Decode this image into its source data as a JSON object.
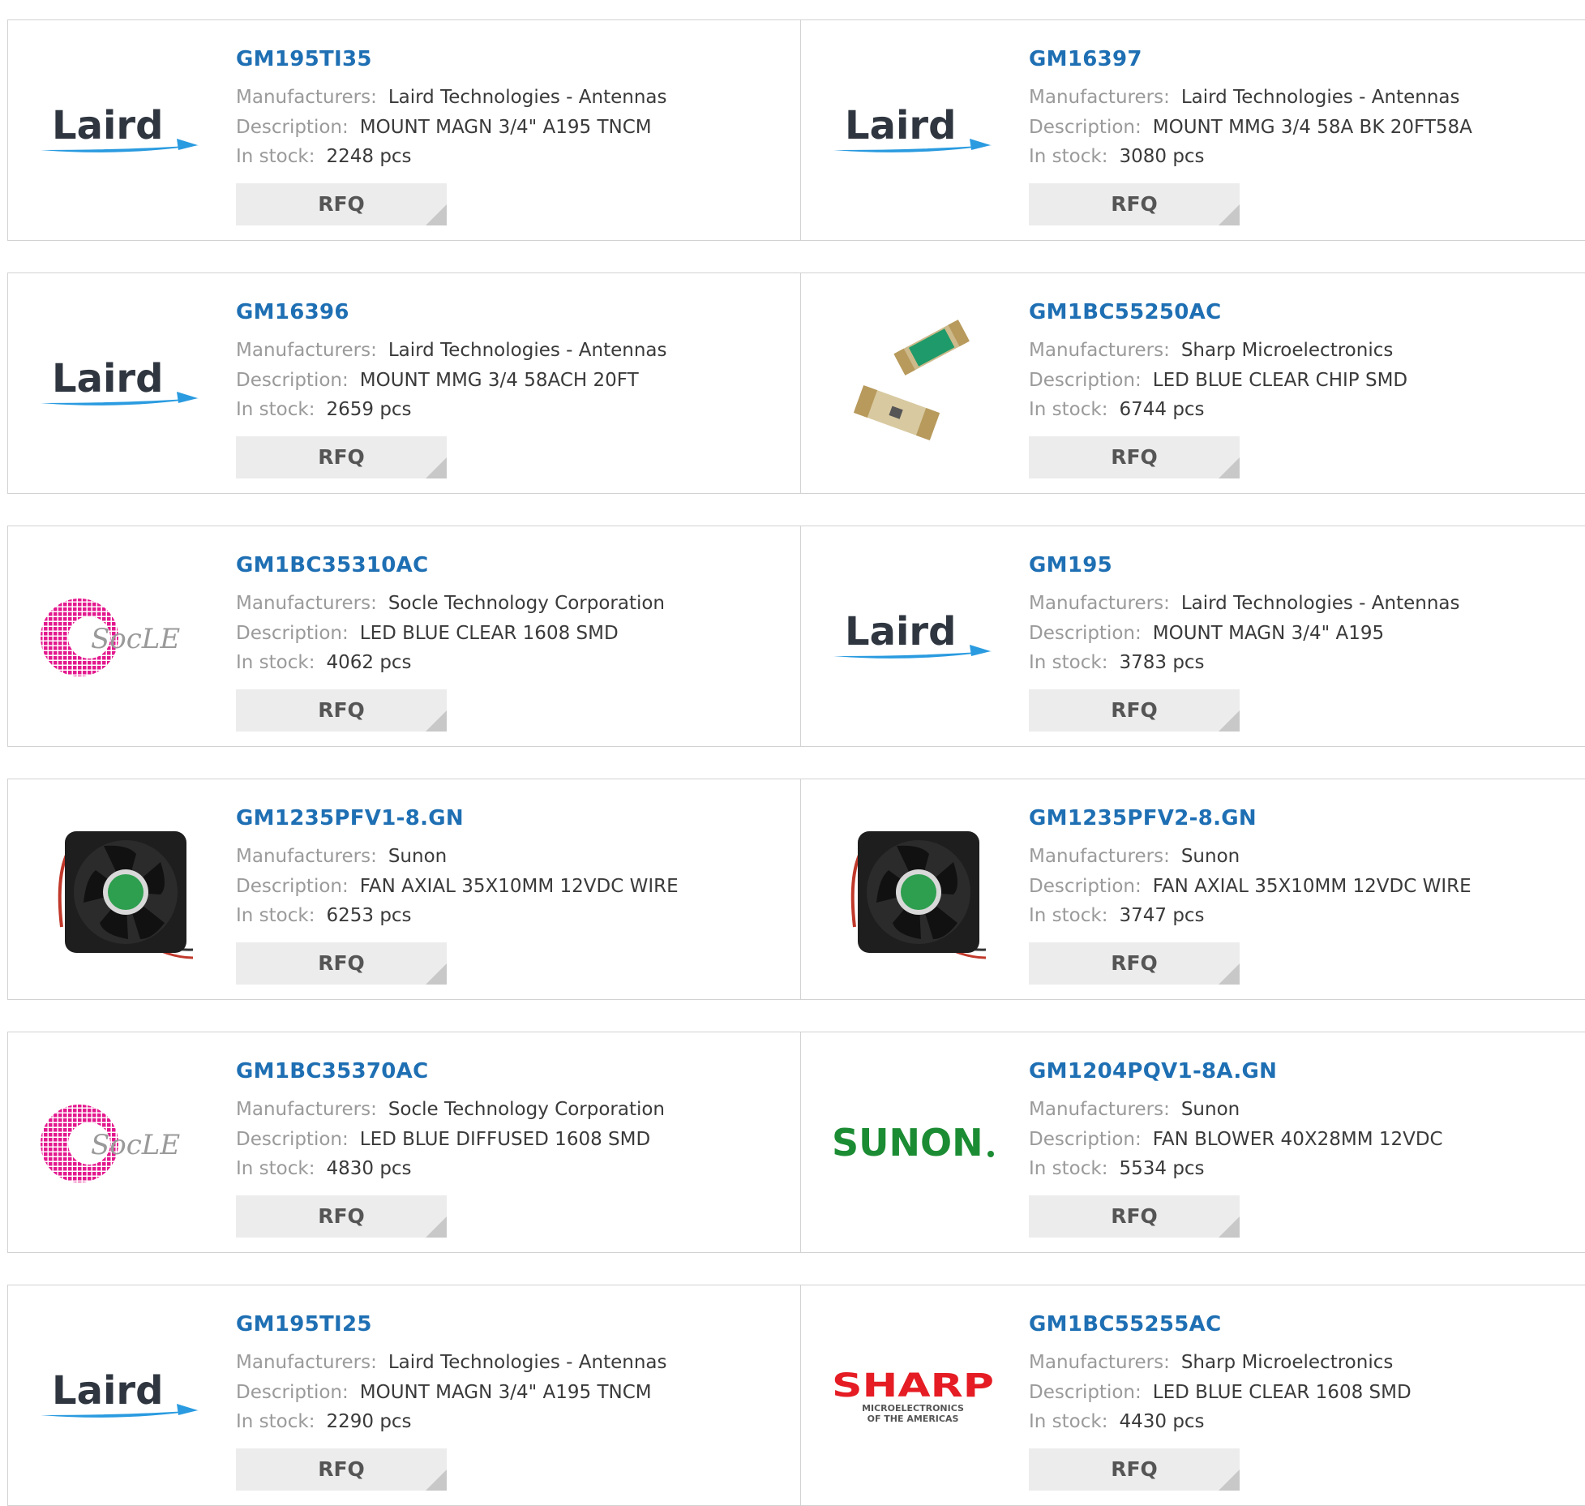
{
  "labels": {
    "manufacturers": "Manufacturers:",
    "description": "Description:",
    "in_stock": "In stock:"
  },
  "rows": [
    {
      "cards": [
        {
          "part_number": "GM195TI35",
          "manufacturer": "Laird Technologies - Antennas",
          "description": "MOUNT MAGN 3/4\" A195 TNCM",
          "stock": "2248 pcs",
          "button": "RFQ",
          "logo": "laird-logo"
        },
        {
          "part_number": "GM16397",
          "manufacturer": "Laird Technologies - Antennas",
          "description": "MOUNT MMG 3/4 58A BK 20FT58A",
          "stock": "3080 pcs",
          "button": "RFQ",
          "logo": "laird-logo"
        }
      ]
    },
    {
      "cards": [
        {
          "part_number": "GM16396",
          "manufacturer": "Laird Technologies - Antennas",
          "description": "MOUNT MMG 3/4 58ACH 20FT",
          "stock": "2659 pcs",
          "button": "RFQ",
          "logo": "laird-logo"
        },
        {
          "part_number": "GM1BC55250AC",
          "manufacturer": "Sharp Microelectronics",
          "description": "LED BLUE CLEAR CHIP SMD",
          "stock": "6744 pcs",
          "button": "RFQ",
          "logo": "led-chip-photo"
        }
      ]
    },
    {
      "cards": [
        {
          "part_number": "GM1BC35310AC",
          "manufacturer": "Socle Technology Corporation",
          "description": "LED BLUE CLEAR 1608 SMD",
          "stock": "4062 pcs",
          "button": "RFQ",
          "logo": "socle-logo"
        },
        {
          "part_number": "GM195",
          "manufacturer": "Laird Technologies - Antennas",
          "description": "MOUNT MAGN 3/4\" A195",
          "stock": "3783 pcs",
          "button": "RFQ",
          "logo": "laird-logo"
        }
      ]
    },
    {
      "cards": [
        {
          "part_number": "GM1235PFV1-8.GN",
          "manufacturer": "Sunon",
          "description": "FAN AXIAL 35X10MM 12VDC WIRE",
          "stock": "6253 pcs",
          "button": "RFQ",
          "logo": "fan-photo"
        },
        {
          "part_number": "GM1235PFV2-8.GN",
          "manufacturer": "Sunon",
          "description": "FAN AXIAL 35X10MM 12VDC WIRE",
          "stock": "3747 pcs",
          "button": "RFQ",
          "logo": "fan-photo"
        }
      ]
    },
    {
      "cards": [
        {
          "part_number": "GM1BC35370AC",
          "manufacturer": "Socle Technology Corporation",
          "description": "LED BLUE DIFFUSED 1608 SMD",
          "stock": "4830 pcs",
          "button": "RFQ",
          "logo": "socle-logo"
        },
        {
          "part_number": "GM1204PQV1-8A.GN",
          "manufacturer": "Sunon",
          "description": "FAN BLOWER 40X28MM 12VDC",
          "stock": "5534 pcs",
          "button": "RFQ",
          "logo": "sunon-logo"
        }
      ]
    },
    {
      "cards": [
        {
          "part_number": "GM195TI25",
          "manufacturer": "Laird Technologies - Antennas",
          "description": "MOUNT MAGN 3/4\" A195 TNCM",
          "stock": "2290 pcs",
          "button": "RFQ",
          "logo": "laird-logo"
        },
        {
          "part_number": "GM1BC55255AC",
          "manufacturer": "Sharp Microelectronics",
          "description": "LED BLUE CLEAR 1608 SMD",
          "stock": "4430 pcs",
          "button": "RFQ",
          "logo": "sharp-logo"
        }
      ]
    }
  ],
  "logo_text": {
    "laird": "Laird",
    "sunon": "SUNON",
    "sharp": "SHARP",
    "sharp_sub1": "MICROELECTRONICS",
    "sharp_sub2": "OF THE AMERICAS",
    "socle": "SocLE"
  },
  "colors": {
    "link": "#1e6fb3",
    "label": "#9a9a9a",
    "value": "#3a3a3a",
    "button_bg": "#ececec",
    "border": "#d2d2d2"
  }
}
